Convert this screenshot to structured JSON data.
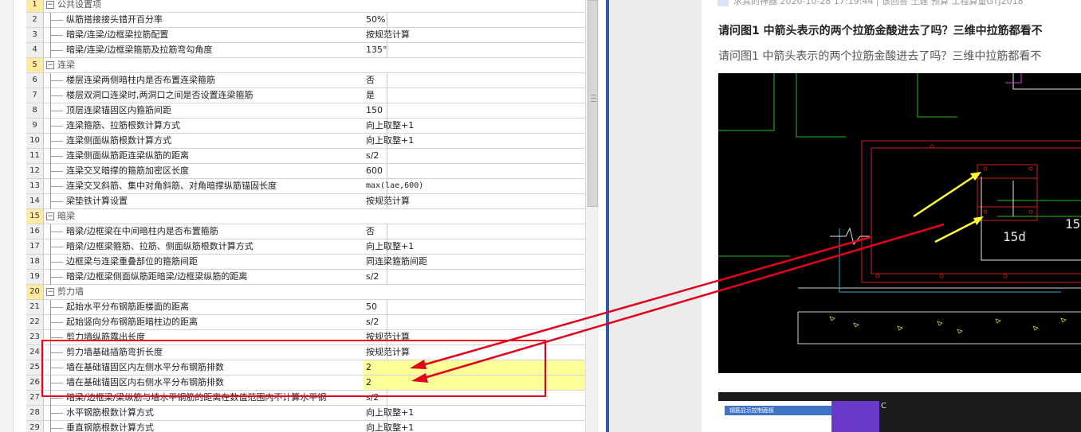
{
  "grid": {
    "rows": [
      {
        "num": "1",
        "type": "cat",
        "toggle": "−",
        "label": "公共设置项"
      },
      {
        "num": "2",
        "type": "item",
        "name": "纵筋搭接接头错开百分率",
        "value": "50%"
      },
      {
        "num": "3",
        "type": "item",
        "name": "暗梁/连梁/边框梁拉筋配置",
        "value": "按规范计算"
      },
      {
        "num": "4",
        "type": "item",
        "name": "暗梁/连梁/边框梁箍筋及拉筋弯勾角度",
        "value": "135°"
      },
      {
        "num": "5",
        "type": "cat",
        "toggle": "−",
        "label": "连梁"
      },
      {
        "num": "6",
        "type": "item",
        "name": "楼层连梁两侧暗柱内是否布置连梁箍筋",
        "value": "否"
      },
      {
        "num": "7",
        "type": "item",
        "name": "楼层双洞口连梁时,两洞口之间是否设置连梁箍筋",
        "value": "是"
      },
      {
        "num": "8",
        "type": "item",
        "name": "顶层连梁锚固区内箍筋间距",
        "value": "150"
      },
      {
        "num": "9",
        "type": "item",
        "name": "连梁箍筋、拉筋根数计算方式",
        "value": "向上取整+1"
      },
      {
        "num": "10",
        "type": "item",
        "name": "连梁侧面纵筋根数计算方式",
        "value": "向上取整+1"
      },
      {
        "num": "11",
        "type": "item",
        "name": "连梁侧面纵筋距连梁纵筋的距离",
        "value": "s/2"
      },
      {
        "num": "12",
        "type": "item",
        "name": "连梁交叉暗撑的箍筋加密区长度",
        "value": "600"
      },
      {
        "num": "13",
        "type": "item",
        "name": "连梁交叉斜筋、集中对角斜筋、对角暗撑纵筋锚固长度",
        "value": "max(lae,600)"
      },
      {
        "num": "14",
        "type": "item",
        "name": "梁垫铁计算设置",
        "value": "按规范计算"
      },
      {
        "num": "15",
        "type": "cat",
        "toggle": "−",
        "label": "暗梁"
      },
      {
        "num": "16",
        "type": "item",
        "name": "暗梁/边框梁在中间暗柱内是否布置箍筋",
        "value": "否"
      },
      {
        "num": "17",
        "type": "item",
        "name": "暗梁/边框梁箍筋、拉筋、侧面纵筋根数计算方式",
        "value": "向上取整+1"
      },
      {
        "num": "18",
        "type": "item",
        "name": "边框梁与连梁重叠部位的箍筋间距",
        "value": "同连梁箍筋间距"
      },
      {
        "num": "19",
        "type": "item",
        "name": "暗梁/边框梁侧面纵筋距暗梁/边框梁纵筋的距离",
        "value": "s/2"
      },
      {
        "num": "20",
        "type": "cat",
        "toggle": "−",
        "label": "剪力墙"
      },
      {
        "num": "21",
        "type": "item",
        "name": "起始水平分布钢筋距楼面的距离",
        "value": "50"
      },
      {
        "num": "22",
        "type": "item",
        "name": "起始竖向分布钢筋距暗柱边的距离",
        "value": "s/2"
      },
      {
        "num": "23",
        "type": "item",
        "name": "剪力墙纵筋露出长度",
        "value": "按规范计算"
      },
      {
        "num": "24",
        "type": "item",
        "name": "剪力墙基础插筋弯折长度",
        "value": "按规范计算"
      },
      {
        "num": "25",
        "type": "item",
        "name": "墙在基础锚固区内左侧水平分布钢筋排数",
        "value": "2",
        "highlight": true
      },
      {
        "num": "26",
        "type": "item",
        "name": "墙在基础锚固区内右侧水平分布钢筋排数",
        "value": "2",
        "highlight": true
      },
      {
        "num": "27",
        "type": "item",
        "name": "暗梁/边框梁/梁纵筋与墙水平钢筋的距离在数值范围内不计算水平钢",
        "value": "s/2"
      },
      {
        "num": "28",
        "type": "item",
        "name": "水平钢筋根数计算方式",
        "value": "向上取整+1"
      },
      {
        "num": "29",
        "type": "item",
        "name": "垂直钢筋根数计算方式",
        "value": "向上取整+1"
      }
    ]
  },
  "article": {
    "meta": "求其的神器 2020-10-28 17:19:44 | 该回答 土建 预算 工程算量GTJ2018",
    "title": "请问图1 中箭头表示的两个拉筋金酸进去了吗？三维中拉筋都看不",
    "body": "请问图1 中箭头表示的两个拉筋金酸进去了吗？三维中拉筋都看不",
    "cad_labels": [
      "15d",
      "15"
    ],
    "thumb_panel_title": "钢筋显示控制面板",
    "thumb_label": "C"
  },
  "colors": {
    "annotation_red": "#e2001a",
    "highlight_yellow": "#ffff99",
    "arrow_yellow": "#ffff33",
    "divider_blue": "#2f5aa8"
  }
}
